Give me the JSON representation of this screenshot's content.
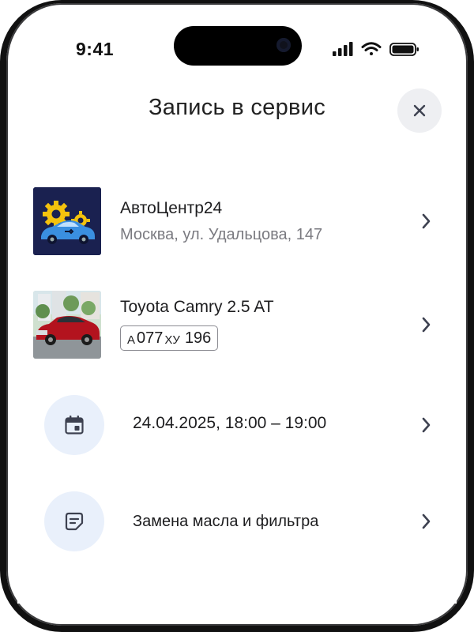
{
  "status_bar": {
    "time": "9:41"
  },
  "header": {
    "title": "Запись в сервис"
  },
  "service_center": {
    "name": "АвтоЦентр24",
    "address": "Москва, ул. Удальцова, 147"
  },
  "vehicle": {
    "name": "Toyota Camry 2.5 AT",
    "plate_part1": "А",
    "plate_part2": "077",
    "plate_part3": "ХУ",
    "plate_region": "196"
  },
  "appointment": {
    "datetime": "24.04.2025, 18:00 – 19:00"
  },
  "service": {
    "name": "Замена масла и фильтра"
  },
  "colors": {
    "accent_bg": "#e9f0fb",
    "icon": "#3d4150",
    "text": "#1d1d1f",
    "secondary": "#7a7a80"
  },
  "icons": [
    "close-icon",
    "chevron-right-icon",
    "calendar-icon",
    "note-icon",
    "signal-icon",
    "wifi-icon",
    "battery-icon"
  ]
}
